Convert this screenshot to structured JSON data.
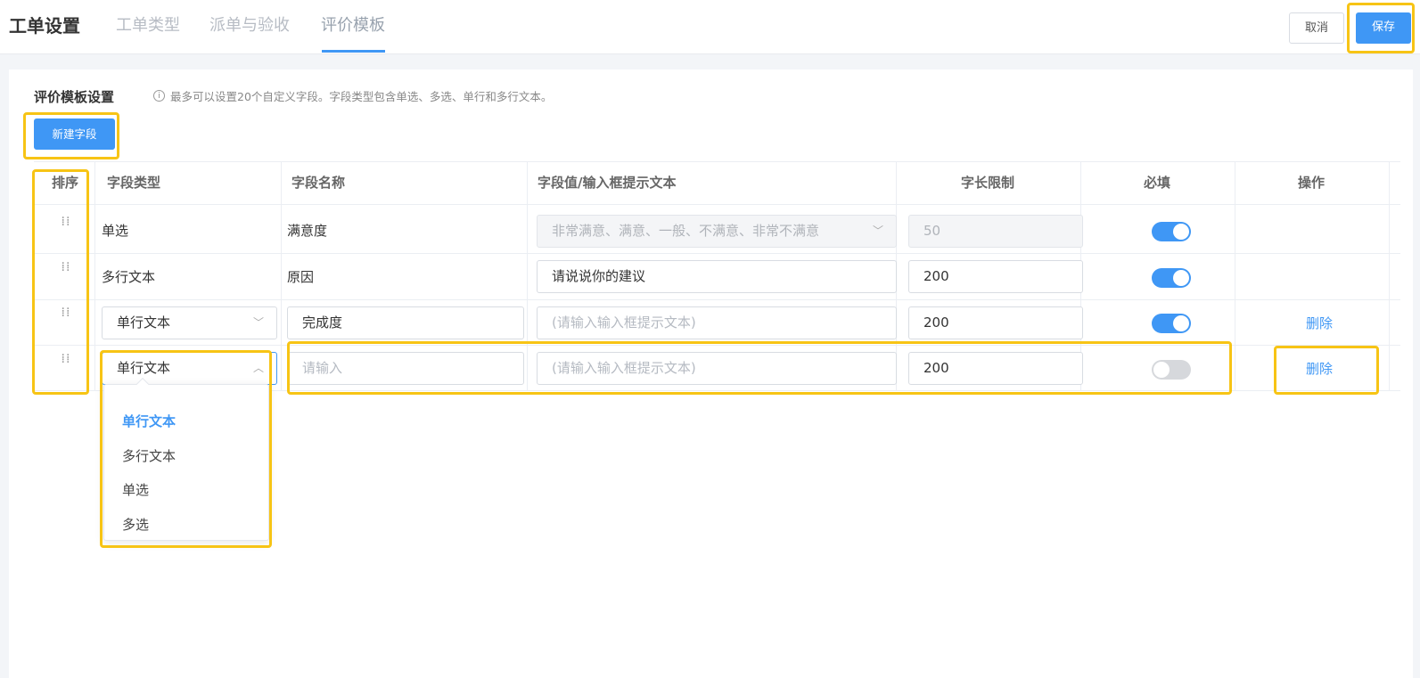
{
  "header": {
    "title": "工单设置",
    "tabs": [
      "工单类型",
      "派单与验收",
      "评价模板"
    ],
    "active_tab": "评价模板",
    "cancel_label": "取消",
    "save_label": "保存"
  },
  "section": {
    "title": "评价模板设置",
    "hint": "最多可以设置20个自定义字段。字段类型包含单选、多选、单行和多行文本。",
    "new_field_label": "新建字段"
  },
  "table": {
    "headers": [
      "排序",
      "字段类型",
      "字段名称",
      "字段值/输入框提示文本",
      "字长限制",
      "必填",
      "操作"
    ],
    "rows": [
      {
        "type": "单选",
        "name": "满意度",
        "value": "非常满意、满意、一般、不满意、非常不满意",
        "limit": "50",
        "required": true,
        "action": ""
      },
      {
        "type": "多行文本",
        "name": "原因",
        "value": "请说说你的建议",
        "limit": "200",
        "required": true,
        "action": ""
      },
      {
        "type": "单行文本",
        "name": "完成度",
        "value": "(请输入输入框提示文本)",
        "limit": "200",
        "required": true,
        "action": "删除"
      },
      {
        "type": "单行文本",
        "name": "请输入",
        "value": "(请输入输入框提示文本)",
        "limit": "200",
        "required": false,
        "action": "删除"
      }
    ]
  },
  "dropdown": {
    "options": [
      "单行文本",
      "多行文本",
      "单选",
      "多选"
    ],
    "selected": "单行文本"
  },
  "icons": {
    "info": "info-circle-icon",
    "drag": "drag-handle-icon",
    "chevron_down": "chevron-down-icon",
    "chevron_up": "chevron-up-icon"
  },
  "colors": {
    "primary": "#3f97f5",
    "highlight": "#f7c415"
  }
}
